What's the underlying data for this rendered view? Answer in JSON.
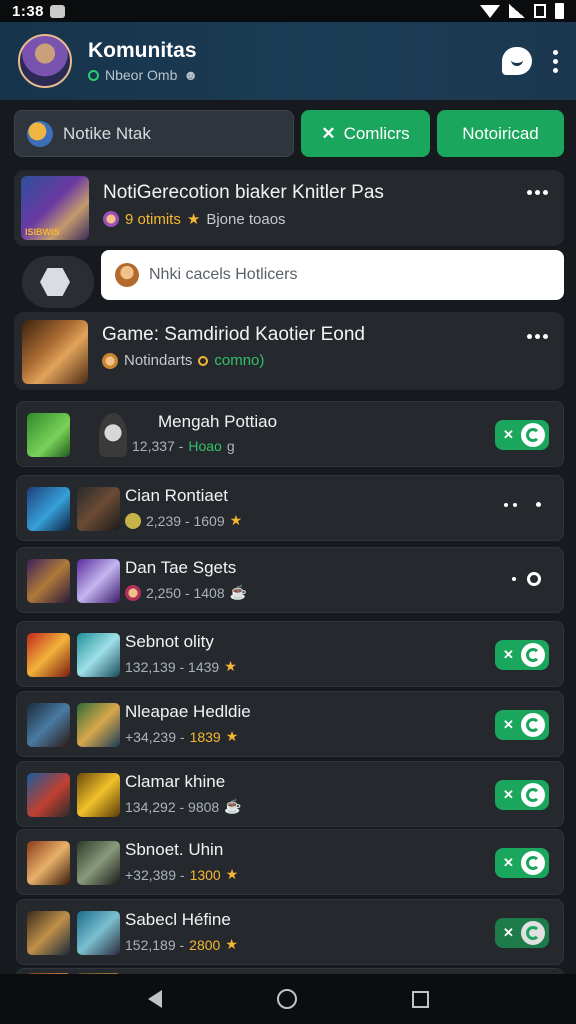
{
  "status_bar": {
    "time": "1:38"
  },
  "header": {
    "title": "Komunitas",
    "subtitle": "Nbeor Omb",
    "avatar_icon": "game-character-avatar",
    "chat_icon": "chat-bubble-icon",
    "menu_icon": "more-vertical-icon"
  },
  "filters": {
    "search_label": "Notike Ntak",
    "komentar_label": "Comlicrs",
    "komentar_prefix": "✕",
    "notif_label": "Notoiricad"
  },
  "posts": [
    {
      "title": "NotiGerecotion biaker Knitler Pas",
      "sub_count": "9 otimits",
      "sub_text": "Bjone toaos",
      "thumb_label": "ISIBWIS"
    },
    {
      "title": "Game: Samdiriod Kaotier Eond",
      "sub_text": "Notindarts",
      "sub_extra": "comno)"
    }
  ],
  "comment": {
    "placeholder": "Nhki cacels Hotlicers"
  },
  "list": [
    {
      "name": "Mengah Pottiao",
      "meta": "12,337 -",
      "meta_extra": "Hoao",
      "meta_suffix": "g",
      "control": "toggle"
    },
    {
      "name": "Cian Rontiaet",
      "meta": "2,239 - 1609",
      "meta_extra": "",
      "meta_suffix": "★",
      "control": "menu"
    },
    {
      "name": "Dan Tae Sgets",
      "meta": "2,250 - 1408",
      "meta_extra": "",
      "meta_suffix": "",
      "control": "dot"
    },
    {
      "name": "Sebnot olity",
      "meta": "132,139 - 1439",
      "meta_extra": "",
      "meta_suffix": "★",
      "control": "toggle"
    },
    {
      "name": "Nleapae Hedldie",
      "meta": "+34,239 -",
      "meta_extra": "1839",
      "meta_suffix": "★",
      "control": "toggle"
    },
    {
      "name": "Clamar khine",
      "meta": "134,292 - 9808",
      "meta_extra": "",
      "meta_suffix": "",
      "control": "toggle"
    },
    {
      "name": "Sbnoet. Uhin",
      "meta": "+32,389 -",
      "meta_extra": "1300",
      "meta_suffix": "★",
      "control": "toggle"
    },
    {
      "name": "Sabecl Héfine",
      "meta": "152,189 -",
      "meta_extra": "2800",
      "meta_suffix": "★",
      "control": "toggle-dim"
    }
  ],
  "colors": {
    "accent_green": "#1aa65d",
    "header_blue": "#1c3c55",
    "background": "#16191d",
    "card": "#25292e",
    "star_gold": "#f5b731"
  }
}
